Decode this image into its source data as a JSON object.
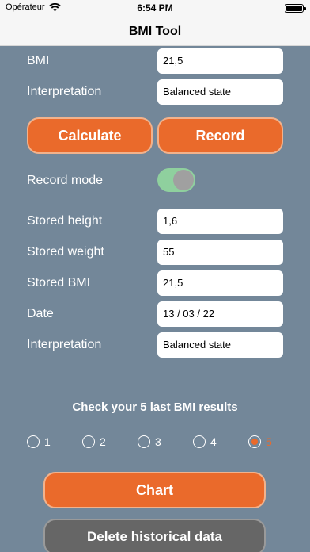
{
  "status_bar": {
    "carrier": "Opérateur",
    "time": "6:54 PM"
  },
  "nav": {
    "title": "BMI Tool"
  },
  "current": {
    "bmi_label": "BMI",
    "bmi_value": "21,5",
    "interp_label": "Interpretation",
    "interp_value": "Balanced state"
  },
  "buttons": {
    "calculate": "Calculate",
    "record": "Record",
    "chart": "Chart",
    "delete": "Delete historical data"
  },
  "record_mode": {
    "label": "Record mode",
    "on": true
  },
  "stored": {
    "height_label": "Stored height",
    "height_value": "1,6",
    "weight_label": "Stored weight",
    "weight_value": "55",
    "bmi_label": "Stored BMI",
    "bmi_value": "21,5",
    "date_label": "Date",
    "date_value": "13 / 03 / 22",
    "interp_label": "Interpretation",
    "interp_value": "Balanced state"
  },
  "history": {
    "link": "Check your 5 last BMI results",
    "options": [
      "1",
      "2",
      "3",
      "4",
      "5"
    ],
    "selected": "5"
  },
  "colors": {
    "background": "#738799",
    "accent": "#ea6a2b",
    "toggle_track": "#8fd09e",
    "delete_button": "#666666"
  }
}
